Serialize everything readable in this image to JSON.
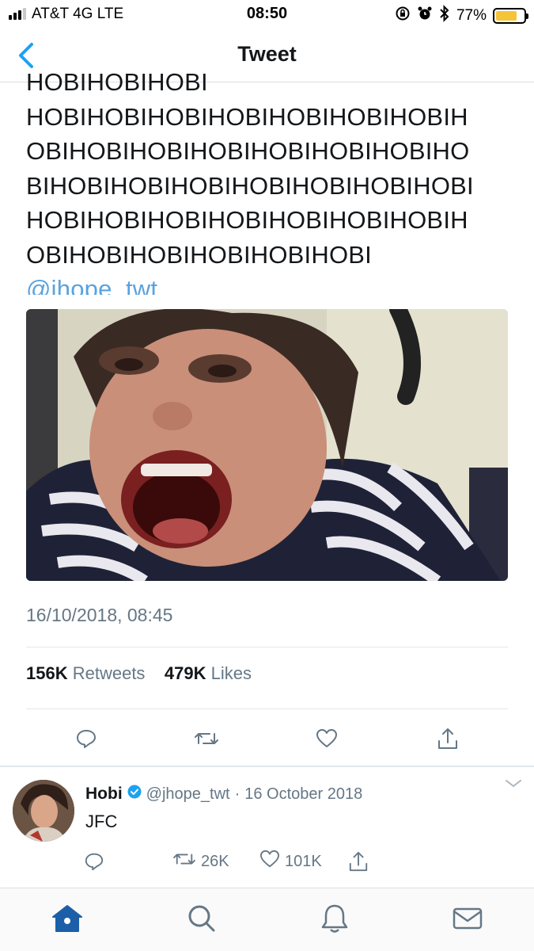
{
  "status_bar": {
    "carrier": "AT&T 4G  LTE",
    "time": "08:50",
    "battery": "77%",
    "battery_level": 0.77
  },
  "nav": {
    "title": "Tweet"
  },
  "tweet": {
    "text_lines": [
      "HOBIHOBIHOBI",
      "HOBIHOBIHOBIHOBIHOBIHOBIHOBIH",
      "OBIHOBIHOBIHOBIHOBIHOBIHOBIHO",
      "BIHOBIHOBIHOBIHOBIHOBIHOBIHOBI",
      "HOBIHOBIHOBIHOBIHOBIHOBIHOBIH",
      "OBIHOBIHOBIHOBIHOBIHOBI"
    ],
    "mention": "@jhope_twt",
    "timestamp": "16/10/2018, 08:45",
    "retweets_count": "156K",
    "retweets_label": "Retweets",
    "likes_count": "479K",
    "likes_label": "Likes"
  },
  "reply": {
    "name": "Hobi",
    "handle": "@jhope_twt",
    "dot": "·",
    "date": "16 October 2018",
    "text": "JFC",
    "retweets": "26K",
    "likes": "101K"
  },
  "colors": {
    "accent": "#1da1f2",
    "mention": "#5aa2de",
    "muted": "#657786",
    "battery": "#f5c43a",
    "tab_active": "#1c5fa8"
  }
}
